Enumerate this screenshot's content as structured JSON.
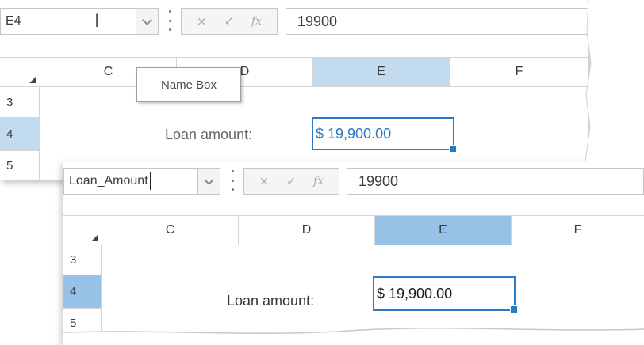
{
  "top": {
    "name_box_value": "E4",
    "formula_value": "19900",
    "columns": [
      "C",
      "D",
      "E",
      "F"
    ],
    "rows": [
      "3",
      "4",
      "5"
    ],
    "label": "Loan amount:",
    "cell_value": "$ 19,900.00",
    "tooltip": "Name Box"
  },
  "bottom": {
    "name_box_value": "Loan_Amount",
    "formula_value": "19900",
    "columns": [
      "C",
      "D",
      "E",
      "F"
    ],
    "rows": [
      "3",
      "4",
      "5"
    ],
    "label": "Loan amount:",
    "cell_value": "$ 19,900.00"
  },
  "formula_buttons": {
    "cancel": "×",
    "enter": "✓",
    "fx": "fx"
  },
  "colors": {
    "selection": "#2b79c4",
    "header_selected": "#c2dbef",
    "active_cell_text": "#2b79c4",
    "active_cell_text_bottom": "#1a1a1a"
  }
}
